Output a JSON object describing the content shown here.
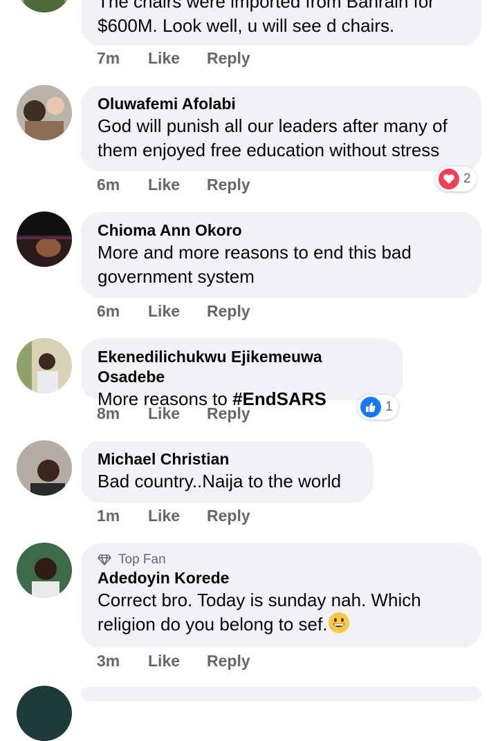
{
  "comments": [
    {
      "lines": [
        "The chairs were imported from Bahrain for",
        "$600M. Look well, u will see d chairs."
      ],
      "time": "7m",
      "like": "Like",
      "reply": "Reply"
    },
    {
      "name": "Oluwafemi Afolabi",
      "lines": [
        "God will punish all our leaders after many of",
        "them enjoyed free education without stress"
      ],
      "time": "6m",
      "like": "Like",
      "reply": "Reply",
      "reaction": {
        "icon": "heart-icon",
        "count": "2",
        "color": "#f33e58"
      }
    },
    {
      "name": "Chioma Ann Okoro",
      "lines": [
        "More and more reasons to end this bad",
        "government system"
      ],
      "time": "6m",
      "like": "Like",
      "reply": "Reply"
    },
    {
      "name": "Ekenedilichukwu Ejikemeuwa Osadebe",
      "text_plain": "More reasons to ",
      "hashtag": "#EndSARS",
      "time": "8m",
      "like": "Like",
      "reply": "Reply",
      "reaction": {
        "icon": "thumbs-up-icon",
        "count": "1",
        "color": "#1877f2"
      }
    },
    {
      "name": "Michael Christian",
      "lines": [
        "Bad country..Naija to the world"
      ],
      "time": "1m",
      "like": "Like",
      "reply": "Reply"
    },
    {
      "badge": "Top Fan",
      "name": "Adedoyin Korede",
      "lines": [
        "Correct bro. Today is sunday nah. Which",
        "religion do you belong to sef."
      ],
      "emoji": "grinning-face",
      "time": "3m",
      "like": "Like",
      "reply": "Reply"
    }
  ],
  "colors": {
    "bubble": "#f0f2f5",
    "meta": "#65676b",
    "text": "#050505"
  }
}
